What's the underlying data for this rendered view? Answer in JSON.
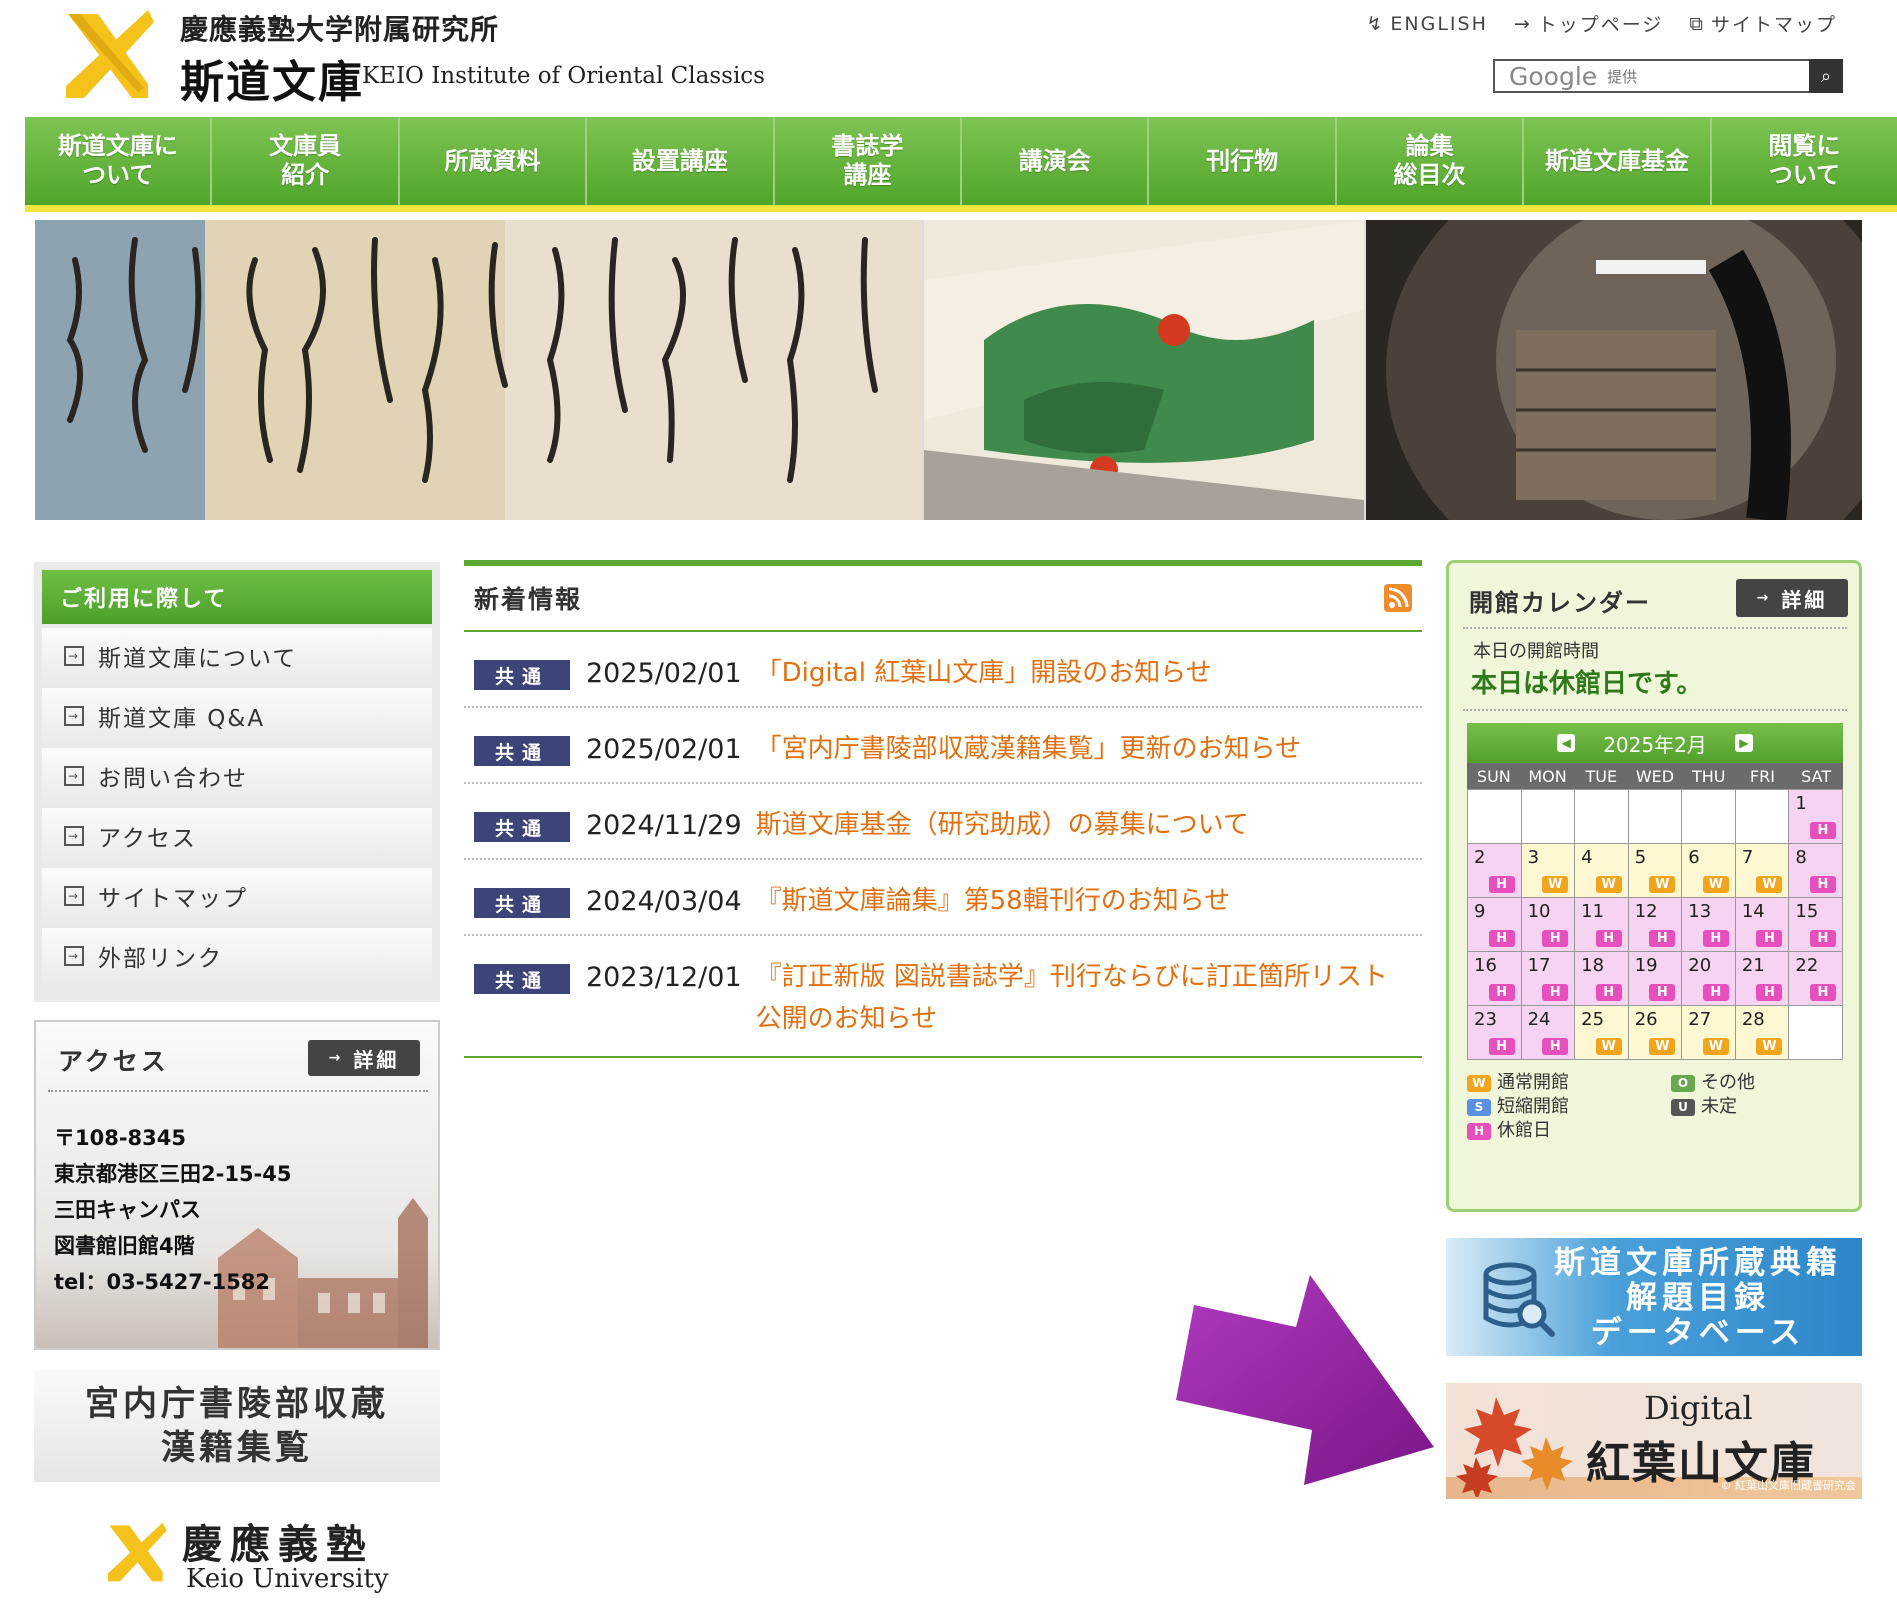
{
  "header": {
    "institution_parent": "慶應義塾大学附属研究所",
    "institution_name": "斯道文庫",
    "institution_en": "KEIO Institute of Oriental Classics",
    "top_links": [
      {
        "label": "ENGLISH",
        "icon": "language-icon"
      },
      {
        "label": "トップページ",
        "icon": "arrow-right-icon"
      },
      {
        "label": "サイトマップ",
        "icon": "sitemap-icon"
      }
    ],
    "search": {
      "brand": "Google",
      "brand_suffix": "提供",
      "button_icon": "search-icon"
    }
  },
  "nav": {
    "items": [
      [
        "斯道文庫に",
        "ついて"
      ],
      [
        "文庫員",
        "紹介"
      ],
      [
        "所蔵資料"
      ],
      [
        "設置講座"
      ],
      [
        "書誌学",
        "講座"
      ],
      [
        "講演会"
      ],
      [
        "刊行物"
      ],
      [
        "論集",
        "総目次"
      ],
      [
        "斯道文庫基金"
      ],
      [
        "閲覧に",
        "ついて"
      ]
    ]
  },
  "sidebar": {
    "usage_title": "ご利用に際して",
    "usage_items": [
      "斯道文庫について",
      "斯道文庫 Q&A",
      "お問い合わせ",
      "アクセス",
      "サイトマップ",
      "外部リンク"
    ],
    "access": {
      "title": "アクセス",
      "detail_label": "詳細",
      "lines": [
        "〒108-8345",
        "東京都港区三田2-15-45",
        "三田キャンパス",
        "図書館旧館4階",
        "tel：03-5427-1582"
      ]
    },
    "kunaicho_banner": [
      "宮内庁書陵部収蔵",
      "漢籍集覧"
    ],
    "keio": {
      "jp": "慶應義塾",
      "en": "Keio University"
    }
  },
  "news": {
    "title": "新着情報",
    "items": [
      {
        "tag": "共通",
        "date": "2025/02/01",
        "text": "「Digital 紅葉山文庫」開設のお知らせ"
      },
      {
        "tag": "共通",
        "date": "2025/02/01",
        "text": "「宮内庁書陵部収蔵漢籍集覧」更新のお知らせ"
      },
      {
        "tag": "共通",
        "date": "2024/11/29",
        "text": "斯道文庫基金（研究助成）の募集について"
      },
      {
        "tag": "共通",
        "date": "2024/03/04",
        "text": "『斯道文庫論集』第58輯刊行のお知らせ"
      },
      {
        "tag": "共通",
        "date": "2023/12/01",
        "text": "『訂正新版 図説書誌学』刊行ならびに訂正箇所リスト公開のお知らせ"
      }
    ]
  },
  "calendar": {
    "title": "開館カレンダー",
    "detail_label": "詳細",
    "today_label": "本日の開館時間",
    "today_status": "本日は休館日です。",
    "month_label": "2025年2月",
    "weekdays": [
      "SUN",
      "MON",
      "TUE",
      "WED",
      "THU",
      "FRI",
      "SAT"
    ],
    "days": [
      {
        "d": "",
        "s": ""
      },
      {
        "d": "",
        "s": ""
      },
      {
        "d": "",
        "s": ""
      },
      {
        "d": "",
        "s": ""
      },
      {
        "d": "",
        "s": ""
      },
      {
        "d": "",
        "s": ""
      },
      {
        "d": "1",
        "s": "H"
      },
      {
        "d": "2",
        "s": "H"
      },
      {
        "d": "3",
        "s": "W"
      },
      {
        "d": "4",
        "s": "W"
      },
      {
        "d": "5",
        "s": "W"
      },
      {
        "d": "6",
        "s": "W"
      },
      {
        "d": "7",
        "s": "W"
      },
      {
        "d": "8",
        "s": "H"
      },
      {
        "d": "9",
        "s": "H"
      },
      {
        "d": "10",
        "s": "H"
      },
      {
        "d": "11",
        "s": "H"
      },
      {
        "d": "12",
        "s": "H"
      },
      {
        "d": "13",
        "s": "H"
      },
      {
        "d": "14",
        "s": "H"
      },
      {
        "d": "15",
        "s": "H"
      },
      {
        "d": "16",
        "s": "H"
      },
      {
        "d": "17",
        "s": "H"
      },
      {
        "d": "18",
        "s": "H"
      },
      {
        "d": "19",
        "s": "H"
      },
      {
        "d": "20",
        "s": "H"
      },
      {
        "d": "21",
        "s": "H"
      },
      {
        "d": "22",
        "s": "H"
      },
      {
        "d": "23",
        "s": "H"
      },
      {
        "d": "24",
        "s": "H"
      },
      {
        "d": "25",
        "s": "W"
      },
      {
        "d": "26",
        "s": "W"
      },
      {
        "d": "27",
        "s": "W"
      },
      {
        "d": "28",
        "s": "W"
      },
      {
        "d": "",
        "s": ""
      }
    ],
    "legend": [
      {
        "code": "W",
        "label": "通常開館",
        "color": "#f0a51d"
      },
      {
        "code": "S",
        "label": "短縮開館",
        "color": "#5b8fe0"
      },
      {
        "code": "H",
        "label": "休館日",
        "color": "#e74fbd"
      },
      {
        "code": "O",
        "label": "その他",
        "color": "#6aa84f"
      },
      {
        "code": "U",
        "label": "未定",
        "color": "#555555"
      }
    ]
  },
  "banners": {
    "database": [
      "斯道文庫所蔵典籍",
      "解題目録",
      "データベース"
    ],
    "momiji": {
      "digital": "Digital",
      "name": "紅葉山文庫",
      "credit": "© 紅葉山文庫旧蔵書研究会"
    }
  },
  "colors": {
    "nav_green": "#5aa832",
    "news_link": "#e07010",
    "tag_navy": "#3c4478",
    "arrow_purple": "#8e1e9a"
  }
}
